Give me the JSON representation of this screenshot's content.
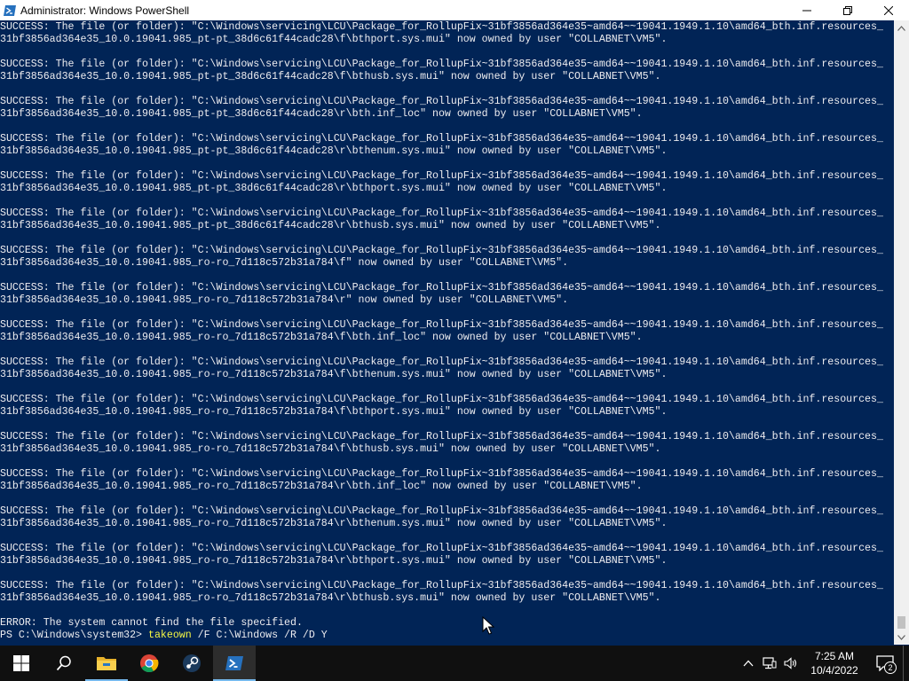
{
  "window": {
    "title": "Administrator: Windows PowerShell",
    "icon": "powershell-icon"
  },
  "console": {
    "lines": [
      "SUCCESS: The file (or folder): \"C:\\Windows\\servicing\\LCU\\Package_for_RollupFix~31bf3856ad364e35~amd64~~19041.1949.1.10\\amd64_bth.inf.resources_",
      "31bf3856ad364e35_10.0.19041.985_pt-pt_38d6c61f44cadc28\\f\\bthport.sys.mui\" now owned by user \"COLLABNET\\VM5\".",
      "",
      "SUCCESS: The file (or folder): \"C:\\Windows\\servicing\\LCU\\Package_for_RollupFix~31bf3856ad364e35~amd64~~19041.1949.1.10\\amd64_bth.inf.resources_",
      "31bf3856ad364e35_10.0.19041.985_pt-pt_38d6c61f44cadc28\\f\\bthusb.sys.mui\" now owned by user \"COLLABNET\\VM5\".",
      "",
      "SUCCESS: The file (or folder): \"C:\\Windows\\servicing\\LCU\\Package_for_RollupFix~31bf3856ad364e35~amd64~~19041.1949.1.10\\amd64_bth.inf.resources_",
      "31bf3856ad364e35_10.0.19041.985_pt-pt_38d6c61f44cadc28\\r\\bth.inf_loc\" now owned by user \"COLLABNET\\VM5\".",
      "",
      "SUCCESS: The file (or folder): \"C:\\Windows\\servicing\\LCU\\Package_for_RollupFix~31bf3856ad364e35~amd64~~19041.1949.1.10\\amd64_bth.inf.resources_",
      "31bf3856ad364e35_10.0.19041.985_pt-pt_38d6c61f44cadc28\\r\\bthenum.sys.mui\" now owned by user \"COLLABNET\\VM5\".",
      "",
      "SUCCESS: The file (or folder): \"C:\\Windows\\servicing\\LCU\\Package_for_RollupFix~31bf3856ad364e35~amd64~~19041.1949.1.10\\amd64_bth.inf.resources_",
      "31bf3856ad364e35_10.0.19041.985_pt-pt_38d6c61f44cadc28\\r\\bthport.sys.mui\" now owned by user \"COLLABNET\\VM5\".",
      "",
      "SUCCESS: The file (or folder): \"C:\\Windows\\servicing\\LCU\\Package_for_RollupFix~31bf3856ad364e35~amd64~~19041.1949.1.10\\amd64_bth.inf.resources_",
      "31bf3856ad364e35_10.0.19041.985_pt-pt_38d6c61f44cadc28\\r\\bthusb.sys.mui\" now owned by user \"COLLABNET\\VM5\".",
      "",
      "SUCCESS: The file (or folder): \"C:\\Windows\\servicing\\LCU\\Package_for_RollupFix~31bf3856ad364e35~amd64~~19041.1949.1.10\\amd64_bth.inf.resources_",
      "31bf3856ad364e35_10.0.19041.985_ro-ro_7d118c572b31a784\\f\" now owned by user \"COLLABNET\\VM5\".",
      "",
      "SUCCESS: The file (or folder): \"C:\\Windows\\servicing\\LCU\\Package_for_RollupFix~31bf3856ad364e35~amd64~~19041.1949.1.10\\amd64_bth.inf.resources_",
      "31bf3856ad364e35_10.0.19041.985_ro-ro_7d118c572b31a784\\r\" now owned by user \"COLLABNET\\VM5\".",
      "",
      "SUCCESS: The file (or folder): \"C:\\Windows\\servicing\\LCU\\Package_for_RollupFix~31bf3856ad364e35~amd64~~19041.1949.1.10\\amd64_bth.inf.resources_",
      "31bf3856ad364e35_10.0.19041.985_ro-ro_7d118c572b31a784\\f\\bth.inf_loc\" now owned by user \"COLLABNET\\VM5\".",
      "",
      "SUCCESS: The file (or folder): \"C:\\Windows\\servicing\\LCU\\Package_for_RollupFix~31bf3856ad364e35~amd64~~19041.1949.1.10\\amd64_bth.inf.resources_",
      "31bf3856ad364e35_10.0.19041.985_ro-ro_7d118c572b31a784\\f\\bthenum.sys.mui\" now owned by user \"COLLABNET\\VM5\".",
      "",
      "SUCCESS: The file (or folder): \"C:\\Windows\\servicing\\LCU\\Package_for_RollupFix~31bf3856ad364e35~amd64~~19041.1949.1.10\\amd64_bth.inf.resources_",
      "31bf3856ad364e35_10.0.19041.985_ro-ro_7d118c572b31a784\\f\\bthport.sys.mui\" now owned by user \"COLLABNET\\VM5\".",
      "",
      "SUCCESS: The file (or folder): \"C:\\Windows\\servicing\\LCU\\Package_for_RollupFix~31bf3856ad364e35~amd64~~19041.1949.1.10\\amd64_bth.inf.resources_",
      "31bf3856ad364e35_10.0.19041.985_ro-ro_7d118c572b31a784\\f\\bthusb.sys.mui\" now owned by user \"COLLABNET\\VM5\".",
      "",
      "SUCCESS: The file (or folder): \"C:\\Windows\\servicing\\LCU\\Package_for_RollupFix~31bf3856ad364e35~amd64~~19041.1949.1.10\\amd64_bth.inf.resources_",
      "31bf3856ad364e35_10.0.19041.985_ro-ro_7d118c572b31a784\\r\\bth.inf_loc\" now owned by user \"COLLABNET\\VM5\".",
      "",
      "SUCCESS: The file (or folder): \"C:\\Windows\\servicing\\LCU\\Package_for_RollupFix~31bf3856ad364e35~amd64~~19041.1949.1.10\\amd64_bth.inf.resources_",
      "31bf3856ad364e35_10.0.19041.985_ro-ro_7d118c572b31a784\\r\\bthenum.sys.mui\" now owned by user \"COLLABNET\\VM5\".",
      "",
      "SUCCESS: The file (or folder): \"C:\\Windows\\servicing\\LCU\\Package_for_RollupFix~31bf3856ad364e35~amd64~~19041.1949.1.10\\amd64_bth.inf.resources_",
      "31bf3856ad364e35_10.0.19041.985_ro-ro_7d118c572b31a784\\r\\bthport.sys.mui\" now owned by user \"COLLABNET\\VM5\".",
      "",
      "SUCCESS: The file (or folder): \"C:\\Windows\\servicing\\LCU\\Package_for_RollupFix~31bf3856ad364e35~amd64~~19041.1949.1.10\\amd64_bth.inf.resources_",
      "31bf3856ad364e35_10.0.19041.985_ro-ro_7d118c572b31a784\\r\\bthusb.sys.mui\" now owned by user \"COLLABNET\\VM5\".",
      "",
      "ERROR: The system cannot find the file specified."
    ],
    "prompt": {
      "path": "PS C:\\Windows\\system32> ",
      "command": "takeown",
      "args": " /F C:\\Windows /R /D Y"
    }
  },
  "colors": {
    "console_bg": "#012456",
    "console_text": "#eeedf0",
    "command_highlight": "#f6f644",
    "taskbar_bg": "#101010"
  },
  "taskbar": {
    "start_icon": "windows-logo-icon",
    "apps": [
      {
        "name": "search-icon"
      },
      {
        "name": "file-explorer-icon"
      },
      {
        "name": "chrome-icon"
      },
      {
        "name": "steam-icon"
      },
      {
        "name": "powershell-icon"
      }
    ],
    "clock": {
      "time": "7:25 AM",
      "date": "10/4/2022"
    },
    "notification_count": "2"
  }
}
